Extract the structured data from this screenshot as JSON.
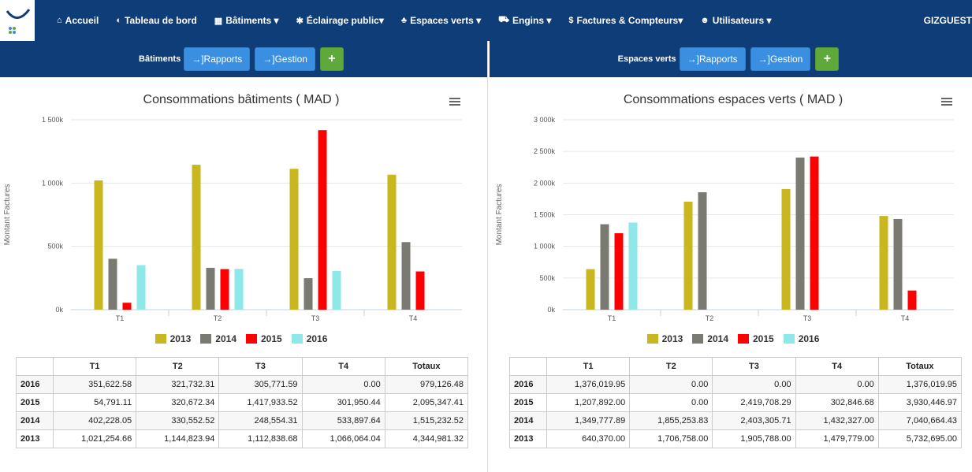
{
  "nav": {
    "items": [
      {
        "icon": "home-icon",
        "glyph": "⌂",
        "label": "Accueil"
      },
      {
        "icon": "dashboard-icon",
        "glyph": "◐",
        "label": "Tableau de bord"
      },
      {
        "icon": "building-icon",
        "glyph": "▦",
        "label": "Bâtiments ▾"
      },
      {
        "icon": "lightbulb-icon",
        "glyph": "✱",
        "label": "Éclairage public▾"
      },
      {
        "icon": "tree-icon",
        "glyph": "♣",
        "label": "Espaces verts ▾"
      },
      {
        "icon": "car-icon",
        "glyph": "⛟",
        "label": "Engins ▾"
      },
      {
        "icon": "dollar-icon",
        "glyph": "$",
        "label": "Factures & Compteurs▾"
      },
      {
        "icon": "user-icon",
        "glyph": "☻",
        "label": "Utilisateurs ▾"
      }
    ],
    "user": "GIZGUEST"
  },
  "left": {
    "section_label": "Bâtiments",
    "rapports": "→]Rapports",
    "gestion": "→]Gestion",
    "add": "+",
    "chart_title": "Consommations bâtiments ( MAD )",
    "table": {
      "headers": [
        "",
        "T1",
        "T2",
        "T3",
        "T4",
        "Totaux"
      ],
      "rows": [
        [
          "2016",
          "351,622.58",
          "321,732.31",
          "305,771.59",
          "0.00",
          "979,126.48"
        ],
        [
          "2015",
          "54,791.11",
          "320,672.34",
          "1,417,933.52",
          "301,950.44",
          "2,095,347.41"
        ],
        [
          "2014",
          "402,228.05",
          "330,552.52",
          "248,554.31",
          "533,897.64",
          "1,515,232.52"
        ],
        [
          "2013",
          "1,021,254.66",
          "1,144,823.94",
          "1,112,838.68",
          "1,066,064.04",
          "4,344,981.32"
        ]
      ]
    }
  },
  "right": {
    "section_label": "Espaces verts",
    "rapports": "→]Rapports",
    "gestion": "→]Gestion",
    "add": "+",
    "chart_title": "Consommations espaces verts ( MAD )",
    "table": {
      "headers": [
        "",
        "T1",
        "T2",
        "T3",
        "T4",
        "Totaux"
      ],
      "rows": [
        [
          "2016",
          "1,376,019.95",
          "0.00",
          "0.00",
          "0.00",
          "1,376,019.95"
        ],
        [
          "2015",
          "1,207,892.00",
          "0.00",
          "2,419,708.29",
          "302,846.68",
          "3,930,446.97"
        ],
        [
          "2014",
          "1,349,777.89",
          "1,855,253.83",
          "2,403,305.71",
          "1,432,327.00",
          "7,040,664.43"
        ],
        [
          "2013",
          "640,370.00",
          "1,706,758.00",
          "1,905,788.00",
          "1,479,779.00",
          "5,732,695.00"
        ]
      ]
    }
  },
  "chart_data": [
    {
      "type": "bar",
      "title": "Consommations bâtiments ( MAD )",
      "xlabel": "",
      "ylabel": "Montant Factures",
      "categories": [
        "T1",
        "T2",
        "T3",
        "T4"
      ],
      "ylim": [
        0,
        1500000
      ],
      "yticks": [
        {
          "v": 0,
          "label": "0k"
        },
        {
          "v": 500000,
          "label": "500k"
        },
        {
          "v": 1000000,
          "label": "1 000k"
        },
        {
          "v": 1500000,
          "label": "1 500k"
        }
      ],
      "grid": true,
      "legend": "bottom",
      "series": [
        {
          "name": "2013",
          "color": "#c8b71e",
          "values": [
            1021254.66,
            1144823.94,
            1112838.68,
            1066064.04
          ]
        },
        {
          "name": "2014",
          "color": "#7a7a72",
          "values": [
            402228.05,
            330552.52,
            248554.31,
            533897.64
          ]
        },
        {
          "name": "2015",
          "color": "#ff0000",
          "values": [
            54791.11,
            320672.34,
            1417933.52,
            301950.44
          ]
        },
        {
          "name": "2016",
          "color": "#8ee8e8",
          "values": [
            351622.58,
            321732.31,
            305771.59,
            0
          ]
        }
      ]
    },
    {
      "type": "bar",
      "title": "Consommations espaces verts ( MAD )",
      "xlabel": "",
      "ylabel": "Montant Factures",
      "categories": [
        "T1",
        "T2",
        "T3",
        "T4"
      ],
      "ylim": [
        0,
        3000000
      ],
      "yticks": [
        {
          "v": 0,
          "label": "0k"
        },
        {
          "v": 500000,
          "label": "500k"
        },
        {
          "v": 1000000,
          "label": "1 000k"
        },
        {
          "v": 1500000,
          "label": "1 500k"
        },
        {
          "v": 2000000,
          "label": "2 000k"
        },
        {
          "v": 2500000,
          "label": "2 500k"
        },
        {
          "v": 3000000,
          "label": "3 000k"
        }
      ],
      "grid": true,
      "legend": "bottom",
      "series": [
        {
          "name": "2013",
          "color": "#c8b71e",
          "values": [
            640370,
            1706758,
            1905788,
            1479779
          ]
        },
        {
          "name": "2014",
          "color": "#7a7a72",
          "values": [
            1349777.89,
            1855253.83,
            2403305.71,
            1432327
          ]
        },
        {
          "name": "2015",
          "color": "#ff0000",
          "values": [
            1207892,
            0,
            2419708.29,
            302846.68
          ]
        },
        {
          "name": "2016",
          "color": "#8ee8e8",
          "values": [
            1376019.95,
            0,
            0,
            0
          ]
        }
      ]
    }
  ]
}
